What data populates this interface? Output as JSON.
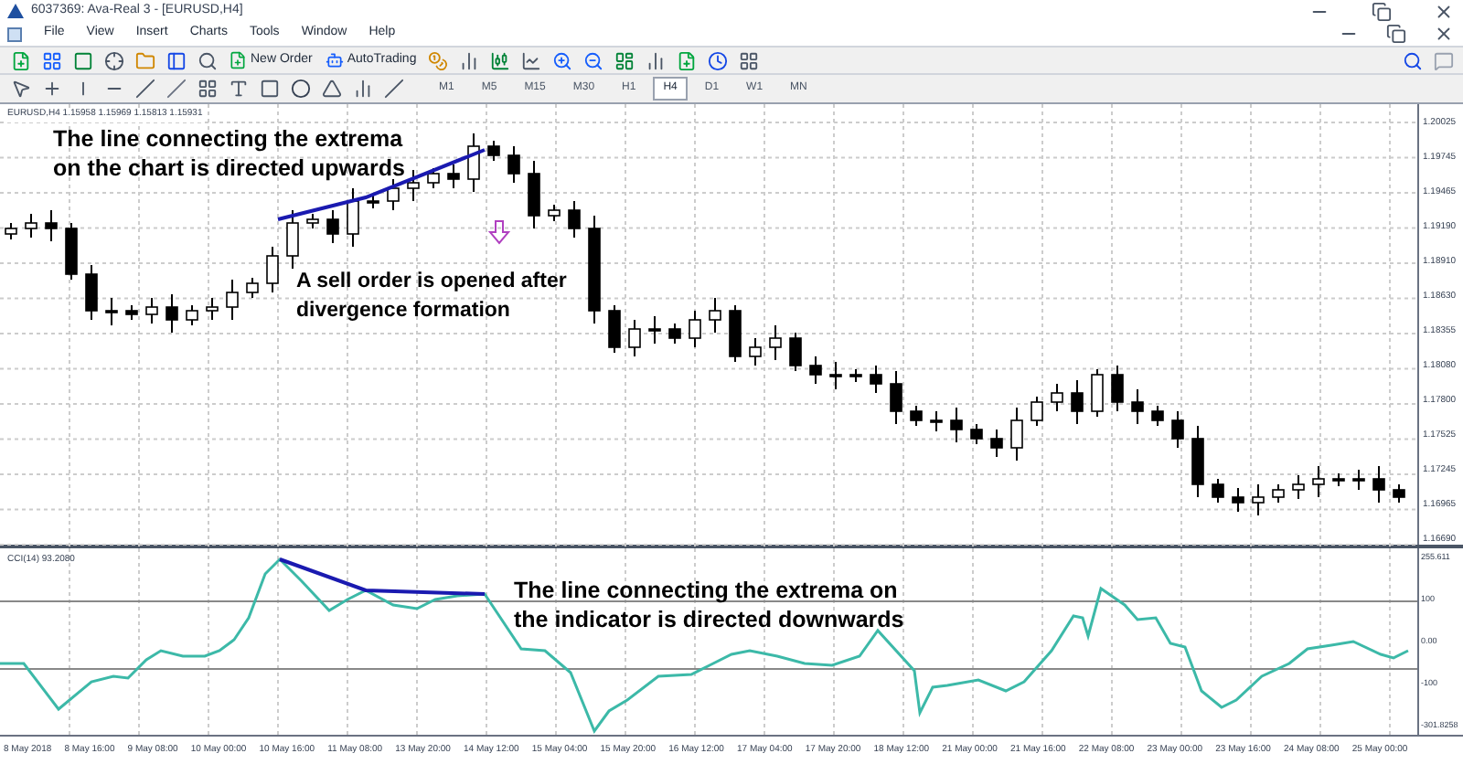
{
  "window": {
    "title": "6037369: Ava-Real 3 - [EURUSD,H4]"
  },
  "menu": [
    "File",
    "View",
    "Insert",
    "Charts",
    "Tools",
    "Window",
    "Help"
  ],
  "toolbar": {
    "buttons": [
      {
        "label": "New Order",
        "kind": "order"
      },
      {
        "label": "AutoTrading",
        "kind": "auto"
      }
    ]
  },
  "timeframes": [
    {
      "label": "M1",
      "selected": false
    },
    {
      "label": "M5",
      "selected": false
    },
    {
      "label": "M15",
      "selected": false
    },
    {
      "label": "M30",
      "selected": false
    },
    {
      "label": "H1",
      "selected": false
    },
    {
      "label": "H4",
      "selected": true
    },
    {
      "label": "D1",
      "selected": false
    },
    {
      "label": "W1",
      "selected": false
    },
    {
      "label": "MN",
      "selected": false
    }
  ],
  "chart": {
    "header": "EURUSD,H4 1.15958 1.15969 1.15813 1.15931",
    "price_labels": [
      "1.20025",
      "1.19745",
      "1.19465",
      "1.19190",
      "1.18910",
      "1.18630",
      "1.18355",
      "1.18080",
      "1.17800",
      "1.17525",
      "1.17245",
      "1.16965",
      "1.16690"
    ],
    "annotations": [
      {
        "text": "The line connecting the extrema on the chart is directed upwards"
      },
      {
        "text": "A sell order is opened after divergence formation"
      }
    ]
  },
  "indicator": {
    "header": "CCI(14) 93.2080",
    "scale_labels": [
      "255.611",
      "100",
      "0.00",
      "-100",
      "-301.8258"
    ],
    "annotation": "The line connecting the extrema on the indicator is directed downwards"
  },
  "time_axis": [
    "8 May 2018",
    "8 May 16:00",
    "9 May 08:00",
    "10 May 00:00",
    "10 May 16:00",
    "11 May 08:00",
    "13 May 20:00",
    "14 May 12:00",
    "15 May 04:00",
    "15 May 20:00",
    "16 May 12:00",
    "17 May 04:00",
    "17 May 20:00",
    "18 May 12:00",
    "21 May 00:00",
    "21 May 16:00",
    "22 May 08:00",
    "23 May 00:00",
    "23 May 16:00",
    "24 May 08:00",
    "25 May 00:00"
  ]
}
